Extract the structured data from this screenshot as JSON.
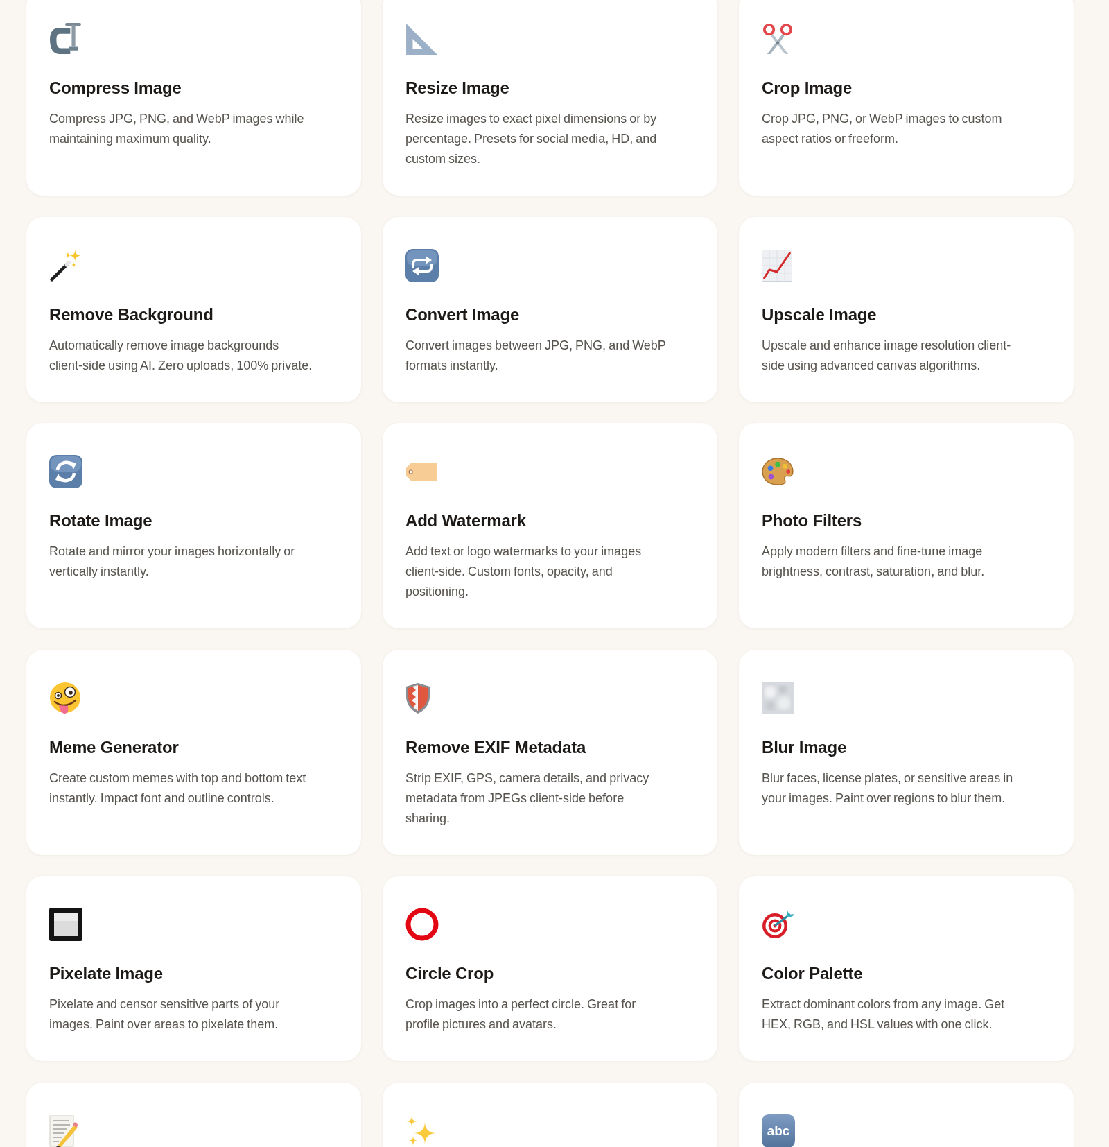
{
  "cards": [
    {
      "title": "Compress Image",
      "description": "Compress JPG, PNG, and WebP images while maintaining maximum quality.",
      "cut_off": false
    },
    {
      "title": "Resize Image",
      "description": "Resize images to exact pixel dimensions or by percentage. Presets for social media, HD, and custom sizes.",
      "cut_off": false
    },
    {
      "title": "Crop Image",
      "description": "Crop JPG, PNG, or WebP images to custom aspect ratios or freeform.",
      "cut_off": false
    },
    {
      "title": "Remove Background",
      "description": "Automatically remove image backgrounds client-side using AI. Zero uploads, 100% private.",
      "cut_off": false
    },
    {
      "title": "Convert Image",
      "description": "Convert images between JPG, PNG, and WebP formats instantly.",
      "cut_off": false
    },
    {
      "title": "Upscale Image",
      "description": "Upscale and enhance image resolution client-side using advanced canvas algorithms.",
      "cut_off": false
    },
    {
      "title": "Rotate Image",
      "description": "Rotate and mirror your images horizontally or vertically instantly.",
      "cut_off": false
    },
    {
      "title": "Add Watermark",
      "description": "Add text or logo watermarks to your images client-side. Custom fonts, opacity, and positioning.",
      "cut_off": false
    },
    {
      "title": "Photo Filters",
      "description": "Apply modern filters and fine-tune image brightness, contrast, saturation, and blur.",
      "cut_off": false
    },
    {
      "title": "Meme Generator",
      "description": "Create custom memes with top and bottom text instantly. Impact font and outline controls.",
      "cut_off": false
    },
    {
      "title": "Remove EXIF Metadata",
      "description": "Strip EXIF, GPS, camera details, and privacy metadata from JPEGs client-side before sharing.",
      "cut_off": false
    },
    {
      "title": "Blur Image",
      "description": "Blur faces, license plates, or sensitive areas in your images. Paint over regions to blur them.",
      "cut_off": false
    },
    {
      "title": "Pixelate Image",
      "description": "Pixelate and censor sensitive parts of your images. Paint over areas to pixelate them.",
      "cut_off": false
    },
    {
      "title": "Circle Crop",
      "description": "Crop images into a perfect circle. Great for profile pictures and avatars.",
      "cut_off": false
    },
    {
      "title": "Color Palette",
      "description": "Extract dominant colors from any image. Get HEX, RGB, and HSL values with one click.",
      "cut_off": false
    },
    {
      "cut_off": true
    },
    {
      "cut_off": true
    },
    {
      "icon_text": "abc",
      "cut_off": true
    }
  ]
}
